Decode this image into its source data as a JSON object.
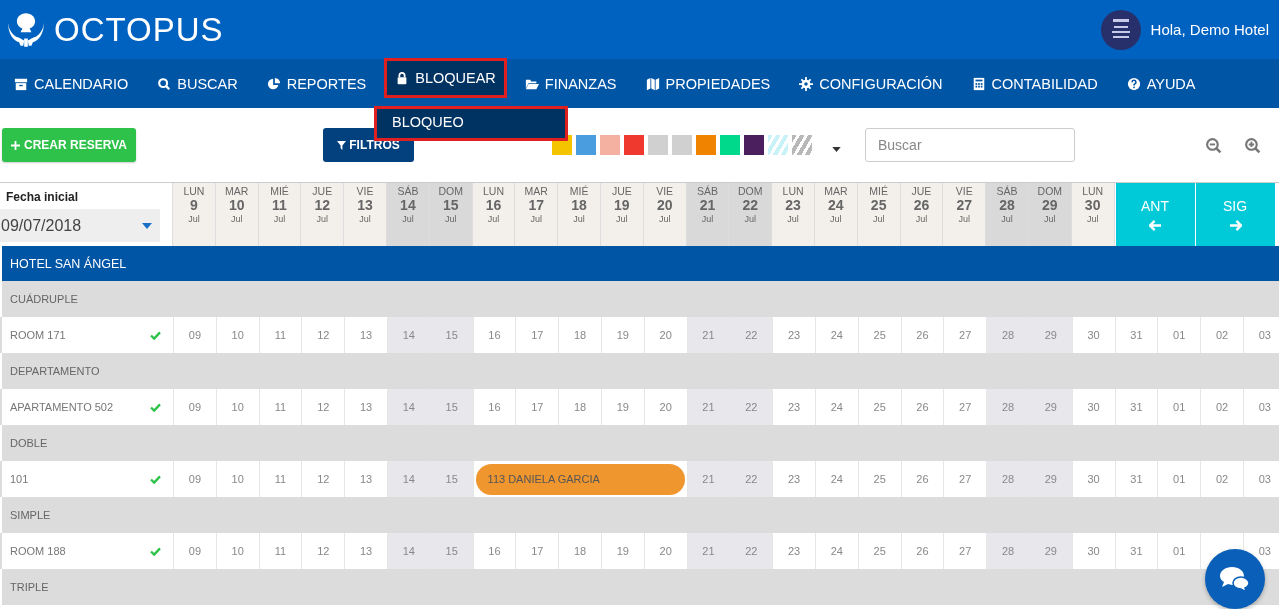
{
  "brand": "OCTOPUS",
  "user": {
    "greeting": "Hola, Demo Hotel"
  },
  "nav": [
    {
      "label": "CALENDARIO",
      "selected": false
    },
    {
      "label": "BUSCAR",
      "selected": false
    },
    {
      "label": "REPORTES",
      "selected": false
    },
    {
      "label": "BLOQUEAR",
      "selected": true
    },
    {
      "label": "FINANZAS",
      "selected": false
    },
    {
      "label": "PROPIEDADES",
      "selected": false
    },
    {
      "label": "CONFIGURACIÓN",
      "selected": false
    },
    {
      "label": "CONTABILIDAD",
      "selected": false
    },
    {
      "label": "AYUDA",
      "selected": false
    }
  ],
  "dropdown": [
    {
      "label": "BLOQUEO",
      "selected": true
    }
  ],
  "toolbar": {
    "create_button": "CREAR RESERVA",
    "filter_button": "FILTROS",
    "search": {
      "placeholder": "Buscar"
    },
    "swatches": [
      {
        "kind": "solid",
        "color": "#f5c400"
      },
      {
        "kind": "solid",
        "color": "#4a9ee0"
      },
      {
        "kind": "solid",
        "color": "#f4b0a0"
      },
      {
        "kind": "solid",
        "color": "#f0392e"
      },
      {
        "kind": "solid",
        "color": "#d0d0d0"
      },
      {
        "kind": "solid",
        "color": "#d0d0d0"
      },
      {
        "kind": "solid",
        "color": "#f08300"
      },
      {
        "kind": "solid",
        "color": "#00d98b"
      },
      {
        "kind": "solid",
        "color": "#4b1e5e"
      },
      {
        "kind": "striped",
        "color": "#c8f2f8"
      },
      {
        "kind": "striped",
        "color": "#b8b8b8"
      }
    ]
  },
  "start_date": {
    "label": "Fecha inicial",
    "value": "09/07/2018"
  },
  "days": [
    {
      "dow": "LUN",
      "num": "9",
      "month": "Jul",
      "weekend": false
    },
    {
      "dow": "MAR",
      "num": "10",
      "month": "Jul",
      "weekend": false
    },
    {
      "dow": "MIÉ",
      "num": "11",
      "month": "Jul",
      "weekend": false
    },
    {
      "dow": "JUE",
      "num": "12",
      "month": "Jul",
      "weekend": false
    },
    {
      "dow": "VIE",
      "num": "13",
      "month": "Jul",
      "weekend": false
    },
    {
      "dow": "SÁB",
      "num": "14",
      "month": "Jul",
      "weekend": true
    },
    {
      "dow": "DOM",
      "num": "15",
      "month": "Jul",
      "weekend": true
    },
    {
      "dow": "LUN",
      "num": "16",
      "month": "Jul",
      "weekend": false
    },
    {
      "dow": "MAR",
      "num": "17",
      "month": "Jul",
      "weekend": false
    },
    {
      "dow": "MIÉ",
      "num": "18",
      "month": "Jul",
      "weekend": false
    },
    {
      "dow": "JUE",
      "num": "19",
      "month": "Jul",
      "weekend": false
    },
    {
      "dow": "VIE",
      "num": "20",
      "month": "Jul",
      "weekend": false
    },
    {
      "dow": "SÁB",
      "num": "21",
      "month": "Jul",
      "weekend": true
    },
    {
      "dow": "DOM",
      "num": "22",
      "month": "Jul",
      "weekend": true
    },
    {
      "dow": "LUN",
      "num": "23",
      "month": "Jul",
      "weekend": false
    },
    {
      "dow": "MAR",
      "num": "24",
      "month": "Jul",
      "weekend": false
    },
    {
      "dow": "MIÉ",
      "num": "25",
      "month": "Jul",
      "weekend": false
    },
    {
      "dow": "JUE",
      "num": "26",
      "month": "Jul",
      "weekend": false
    },
    {
      "dow": "VIE",
      "num": "27",
      "month": "Jul",
      "weekend": false
    },
    {
      "dow": "SÁB",
      "num": "28",
      "month": "Jul",
      "weekend": true
    },
    {
      "dow": "DOM",
      "num": "29",
      "month": "Jul",
      "weekend": true
    },
    {
      "dow": "LUN",
      "num": "30",
      "month": "Jul",
      "weekend": false
    }
  ],
  "pager": [
    {
      "label": "ANT",
      "kind": "prev"
    },
    {
      "label": "SIG",
      "kind": "next"
    }
  ],
  "hotel": "HOTEL SAN ÁNGEL",
  "groups": [
    {
      "type": "CUÁDRUPLE",
      "rooms": [
        {
          "name": "ROOM 171",
          "available": true,
          "cells": [
            {
              "text": "09"
            },
            {
              "text": "10"
            },
            {
              "text": "11"
            },
            {
              "text": "12"
            },
            {
              "text": "13"
            },
            {
              "text": "14"
            },
            {
              "text": "15"
            },
            {
              "text": "16"
            },
            {
              "text": "17"
            },
            {
              "text": "18"
            },
            {
              "text": "19"
            },
            {
              "text": "20"
            },
            {
              "text": "21"
            },
            {
              "text": "22"
            },
            {
              "text": "23"
            },
            {
              "text": "24"
            },
            {
              "text": "25"
            },
            {
              "text": "26"
            },
            {
              "text": "27"
            },
            {
              "text": "28"
            },
            {
              "text": "29"
            },
            {
              "text": "30"
            },
            {
              "text": "31"
            },
            {
              "text": "01"
            },
            {
              "text": "02"
            },
            {
              "text": "03"
            }
          ]
        }
      ]
    },
    {
      "type": "DEPARTAMENTO",
      "rooms": [
        {
          "name": "APARTAMENTO 502",
          "available": true,
          "cells": [
            {
              "text": "09"
            },
            {
              "text": "10"
            },
            {
              "text": "11"
            },
            {
              "text": "12"
            },
            {
              "text": "13"
            },
            {
              "text": "14"
            },
            {
              "text": "15"
            },
            {
              "text": "16"
            },
            {
              "text": "17"
            },
            {
              "text": "18"
            },
            {
              "text": "19"
            },
            {
              "text": "20"
            },
            {
              "text": "21"
            },
            {
              "text": "22"
            },
            {
              "text": "23"
            },
            {
              "text": "24"
            },
            {
              "text": "25"
            },
            {
              "text": "26"
            },
            {
              "text": "27"
            },
            {
              "text": "28"
            },
            {
              "text": "29"
            },
            {
              "text": "30"
            },
            {
              "text": "31"
            },
            {
              "text": "01"
            },
            {
              "text": "02"
            },
            {
              "text": "03"
            }
          ]
        }
      ]
    },
    {
      "type": "DOBLE",
      "rooms": [
        {
          "name": "101",
          "available": true,
          "cells": [
            {
              "text": "09"
            },
            {
              "text": "10"
            },
            {
              "text": "11"
            },
            {
              "text": "12"
            },
            {
              "text": "13"
            },
            {
              "text": "14"
            },
            {
              "text": "15"
            },
            {
              "kind": "booking",
              "text": "113 DANIELA GARCIA"
            },
            {
              "text": "21"
            },
            {
              "text": "22"
            },
            {
              "text": "23"
            },
            {
              "text": "24"
            },
            {
              "text": "25"
            },
            {
              "text": "26"
            },
            {
              "text": "27"
            },
            {
              "text": "28"
            },
            {
              "text": "29"
            },
            {
              "text": "30"
            },
            {
              "text": "31"
            },
            {
              "text": "01"
            },
            {
              "text": "02"
            },
            {
              "text": "03"
            }
          ]
        }
      ]
    },
    {
      "type": "SIMPLE",
      "rooms": [
        {
          "name": "ROOM 188",
          "available": true,
          "cells": [
            {
              "text": "09"
            },
            {
              "text": "10"
            },
            {
              "text": "11"
            },
            {
              "text": "12"
            },
            {
              "text": "13"
            },
            {
              "text": "14"
            },
            {
              "text": "15"
            },
            {
              "text": "16"
            },
            {
              "text": "17"
            },
            {
              "text": "18"
            },
            {
              "text": "19"
            },
            {
              "text": "20"
            },
            {
              "text": "21"
            },
            {
              "text": "22"
            },
            {
              "text": "23"
            },
            {
              "text": "24"
            },
            {
              "text": "25"
            },
            {
              "text": "26"
            },
            {
              "text": "27"
            },
            {
              "text": "28"
            },
            {
              "text": "29"
            },
            {
              "text": "30"
            },
            {
              "text": "31"
            },
            {
              "text": "01"
            },
            {
              "kind": "covered"
            },
            {
              "text": "03"
            }
          ]
        }
      ]
    },
    {
      "type": "TRIPLE"
    }
  ]
}
